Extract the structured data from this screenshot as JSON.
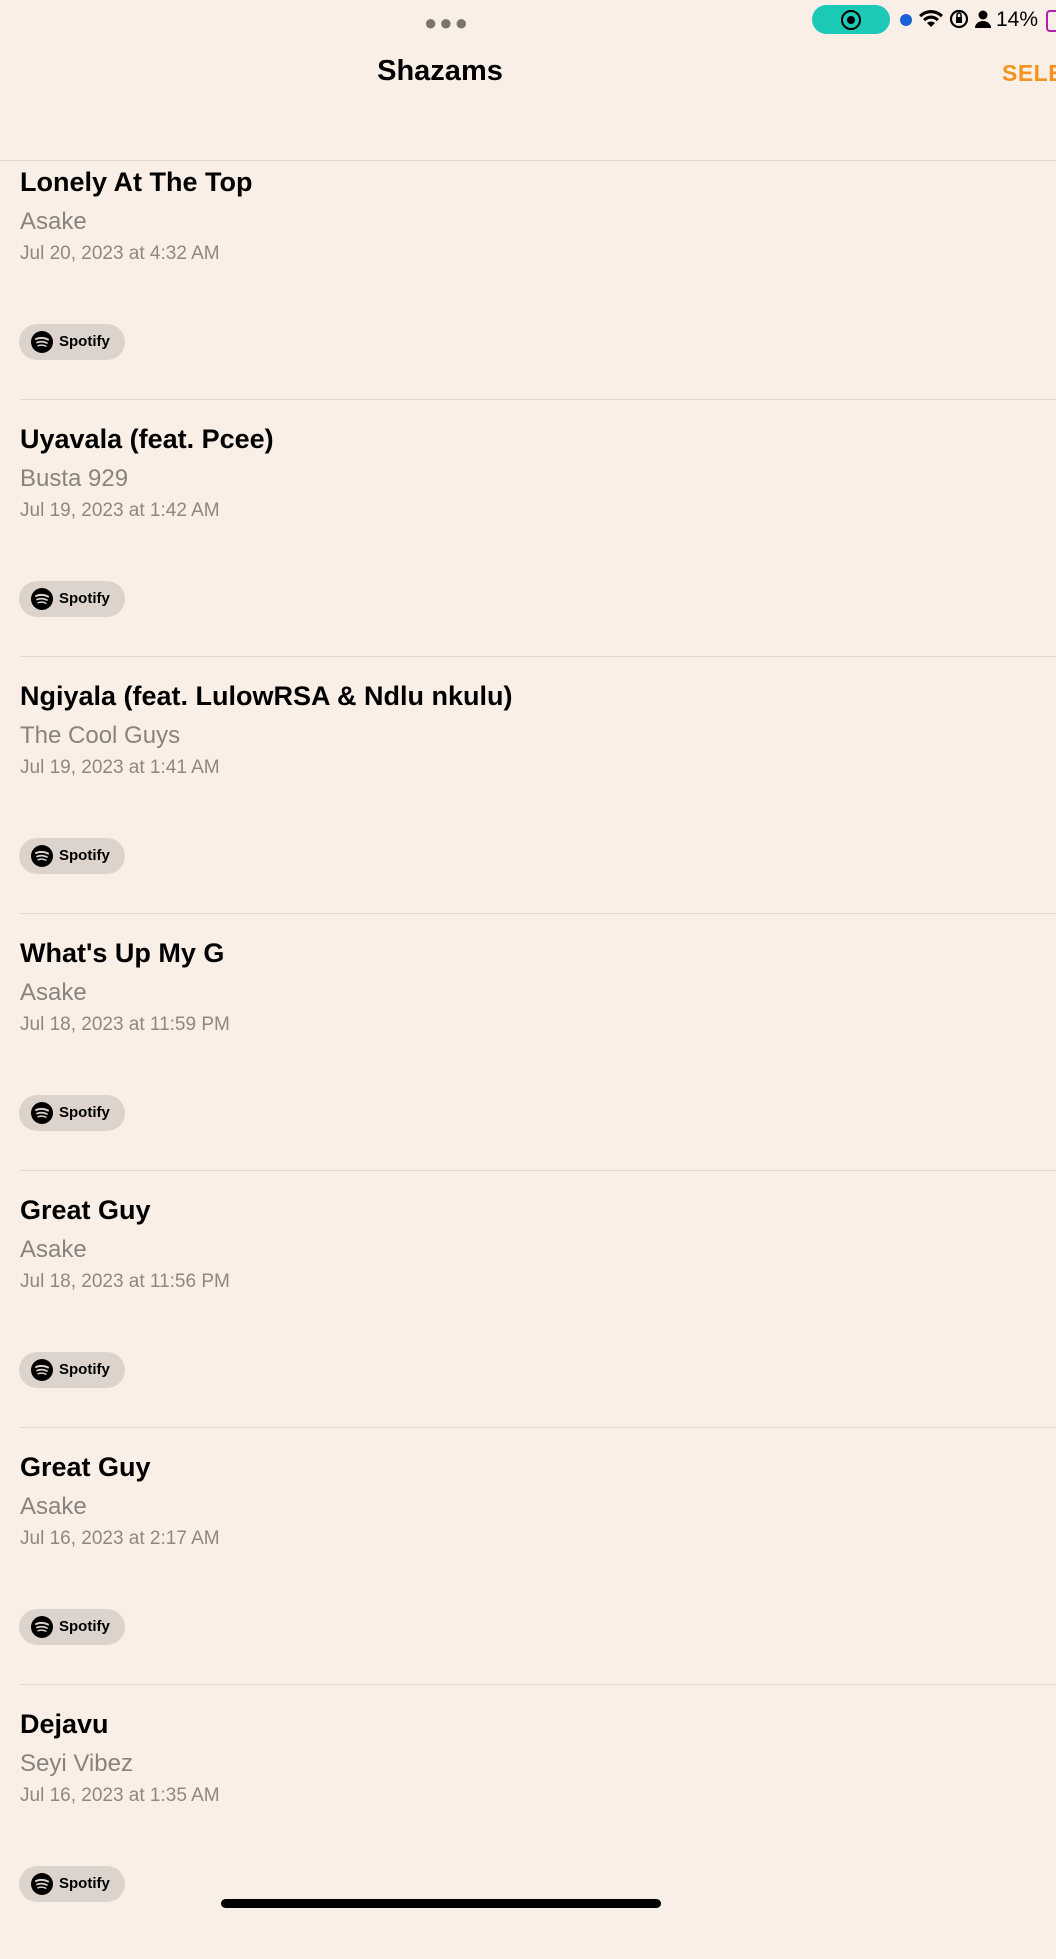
{
  "status_bar": {
    "battery_percent": "14%",
    "icons": [
      "more-dots-icon",
      "screen-record-icon",
      "mic-indicator-icon",
      "wifi-icon",
      "rotation-lock-icon",
      "person-icon",
      "battery-icon"
    ],
    "colors": {
      "record_pill": "#1cc9b7",
      "indicator_dot": "#1a5fd6",
      "battery": "#b41fb0"
    }
  },
  "navbar": {
    "title": "Shazams",
    "select_label": "SELE",
    "select_color": "#f2941e"
  },
  "shazams": [
    {
      "title": "Lonely At The Top",
      "artist": "Asake",
      "date": "Jul 20, 2023 at 4:32 AM",
      "service": "Spotify"
    },
    {
      "title": "Uyavala (feat. Pcee)",
      "artist": "Busta 929",
      "date": "Jul 19, 2023 at 1:42 AM",
      "service": "Spotify"
    },
    {
      "title": "Ngiyala (feat. LulowRSA & Ndlu nkulu)",
      "artist": "The Cool Guys",
      "date": "Jul 19, 2023 at 1:41 AM",
      "service": "Spotify"
    },
    {
      "title": "What's Up My G",
      "artist": "Asake",
      "date": "Jul 18, 2023 at 11:59 PM",
      "service": "Spotify"
    },
    {
      "title": "Great Guy",
      "artist": "Asake",
      "date": "Jul 18, 2023 at 11:56 PM",
      "service": "Spotify"
    },
    {
      "title": "Great Guy",
      "artist": "Asake",
      "date": "Jul 16, 2023 at 2:17 AM",
      "service": "Spotify"
    },
    {
      "title": "Dejavu",
      "artist": "Seyi Vibez",
      "date": "Jul 16, 2023 at 1:35 AM",
      "service": "Spotify"
    }
  ]
}
